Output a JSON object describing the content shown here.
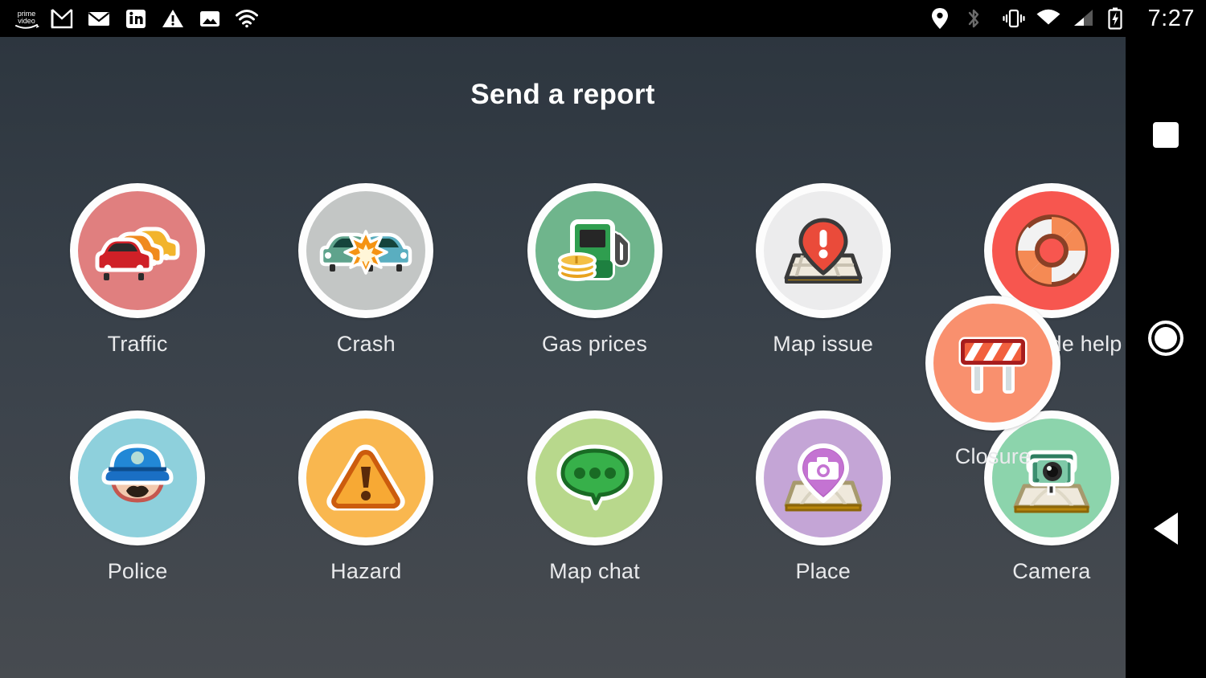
{
  "status_bar": {
    "left_icons": [
      {
        "name": "prime-video-icon",
        "label": "prime video"
      },
      {
        "name": "gmail-icon",
        "label": "Gmail"
      },
      {
        "name": "email-icon",
        "label": "Email"
      },
      {
        "name": "linkedin-icon",
        "label": "in"
      },
      {
        "name": "warning-icon",
        "label": "Warning"
      },
      {
        "name": "photos-icon",
        "label": "Photo"
      },
      {
        "name": "wifi-icon",
        "label": "Wi-Fi"
      }
    ],
    "right_icons": [
      {
        "name": "location-pin-icon",
        "label": "Location"
      },
      {
        "name": "bluetooth-icon",
        "label": "Bluetooth"
      },
      {
        "name": "vibrate-icon",
        "label": "Vibrate"
      },
      {
        "name": "wifi-icon",
        "label": "Wi-Fi"
      },
      {
        "name": "cell-signal-icon",
        "label": "Signal"
      },
      {
        "name": "battery-charging-icon",
        "label": "Battery charging"
      }
    ],
    "clock": "7:27"
  },
  "header": {
    "title": "Send a report"
  },
  "colors": {
    "background_top": "#2d363f",
    "background_bottom": "#474b50",
    "status_bar_background": "#000000",
    "title_text": "#ffffff",
    "label_text": "#e9eaec",
    "circle_ring": "#fdfdfd"
  },
  "report_options": {
    "row1": [
      {
        "id": "traffic",
        "label": "Traffic",
        "icon": "traffic-cars-icon",
        "circle_color": "#e07f7f"
      },
      {
        "id": "crash",
        "label": "Crash",
        "icon": "car-crash-icon",
        "circle_color": "#c3c6c5"
      },
      {
        "id": "gas-prices",
        "label": "Gas prices",
        "icon": "gas-pump-icon",
        "circle_color": "#6fb58c"
      },
      {
        "id": "map-issue",
        "label": "Map issue",
        "icon": "map-issue-pin-icon",
        "circle_color": "#ececed"
      },
      {
        "id": "roadside-help",
        "label": "Roadside help",
        "icon": "life-ring-icon",
        "circle_color": "#f7564f"
      }
    ],
    "row2": [
      {
        "id": "police",
        "label": "Police",
        "icon": "police-officer-icon",
        "circle_color": "#8ed0dc"
      },
      {
        "id": "hazard",
        "label": "Hazard",
        "icon": "warning-triangle-icon",
        "circle_color": "#f9b74f"
      },
      {
        "id": "map-chat",
        "label": "Map chat",
        "icon": "speech-bubble-icon",
        "circle_color": "#b8d88c"
      },
      {
        "id": "place",
        "label": "Place",
        "icon": "place-camera-pin-icon",
        "circle_color": "#c4a5d6"
      },
      {
        "id": "camera",
        "label": "Camera",
        "icon": "traffic-camera-icon",
        "circle_color": "#8cd4ac"
      }
    ],
    "floating": {
      "id": "closure",
      "label": "Closure",
      "icon": "road-barrier-icon",
      "circle_color": "#f9906e"
    }
  },
  "navigation_bar": {
    "recents_label": "Overview",
    "home_label": "Home",
    "back_label": "Back"
  }
}
